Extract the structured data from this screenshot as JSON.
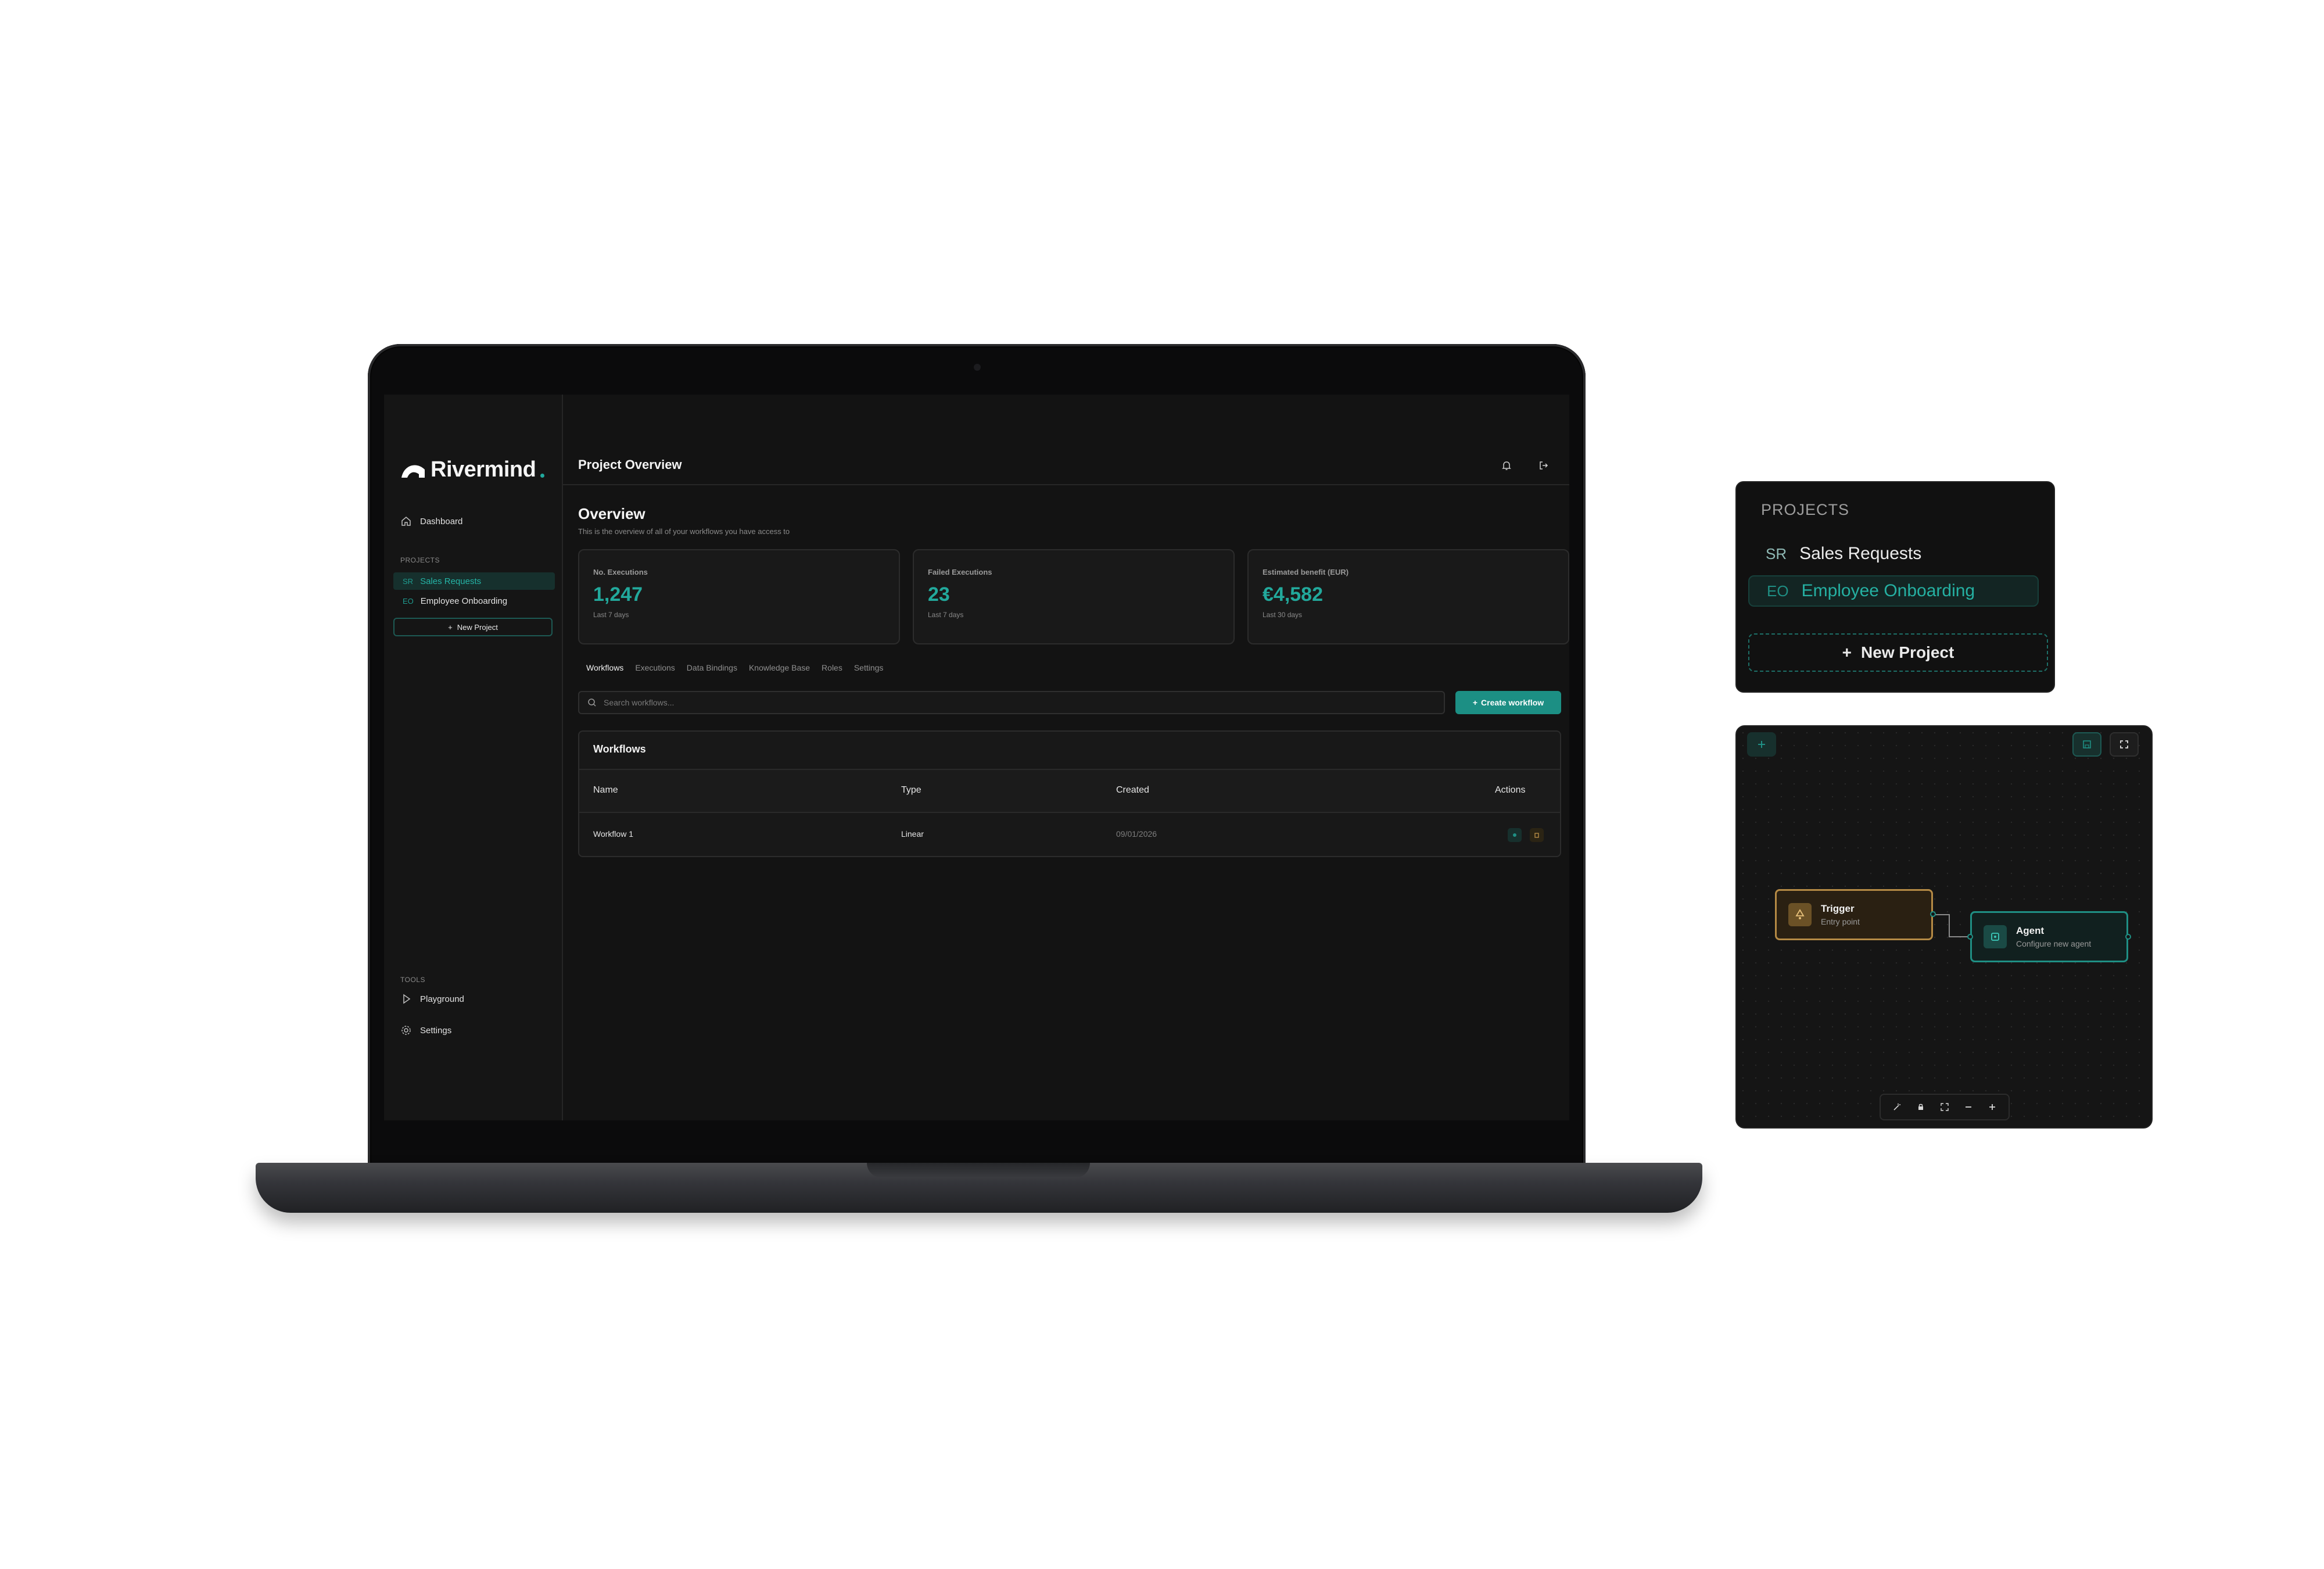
{
  "app": {
    "brand": "Rivermind",
    "accent_color": "#1c8f84"
  },
  "sidebar": {
    "dashboard_label": "Dashboard",
    "projects_section": "PROJECTS",
    "projects": [
      {
        "abbr": "SR",
        "label": "Sales Requests",
        "active": true
      },
      {
        "abbr": "EO",
        "label": "Employee Onboarding",
        "active": false
      }
    ],
    "new_project_label": "New Project",
    "tools_section": "TOOLS",
    "tools": [
      {
        "label": "Playground",
        "icon": "play-icon"
      },
      {
        "label": "Settings",
        "icon": "gear-icon"
      }
    ]
  },
  "header": {
    "title": "Project Overview",
    "icons": [
      "bell-icon",
      "logout-icon"
    ]
  },
  "overview": {
    "title": "Overview",
    "subtitle": "This is the overview of all of your workflows you have access to",
    "stats": [
      {
        "label": "No. Executions",
        "value": "1,247",
        "period": "Last 7 days"
      },
      {
        "label": "Failed Executions",
        "value": "23",
        "period": "Last 7 days"
      },
      {
        "label": "Estimated benefit (EUR)",
        "value": "€4,582",
        "period": "Last 30 days"
      }
    ]
  },
  "tabs": [
    {
      "label": "Workflows",
      "active": true
    },
    {
      "label": "Executions",
      "active": false
    },
    {
      "label": "Data Bindings",
      "active": false
    },
    {
      "label": "Knowledge Base",
      "active": false
    },
    {
      "label": "Roles",
      "active": false
    },
    {
      "label": "Settings",
      "active": false
    }
  ],
  "search": {
    "placeholder": "Search workflows...",
    "value": ""
  },
  "create_workflow_label": "Create workflow",
  "workflows_table": {
    "title": "Workflows",
    "columns": [
      "Name",
      "Type",
      "Created",
      "Actions"
    ],
    "rows": [
      {
        "name": "Workflow 1",
        "type": "Linear",
        "created": "09/01/2026"
      }
    ]
  },
  "projects_panel": {
    "label": "PROJECTS",
    "items": [
      {
        "abbr": "SR",
        "label": "Sales Requests",
        "active": false
      },
      {
        "abbr": "EO",
        "label": "Employee Onboarding",
        "active": true
      }
    ],
    "new_project_label": "New Project"
  },
  "canvas": {
    "nodes": [
      {
        "title": "Trigger",
        "subtitle": "Entry point",
        "color": "#b58a45"
      },
      {
        "title": "Agent",
        "subtitle": "Configure new agent",
        "color": "#1f8f84"
      }
    ],
    "toolbar_icons": [
      "magic-wand-icon",
      "lock-icon",
      "fit-view-icon",
      "zoom-out-icon",
      "zoom-in-icon"
    ]
  }
}
